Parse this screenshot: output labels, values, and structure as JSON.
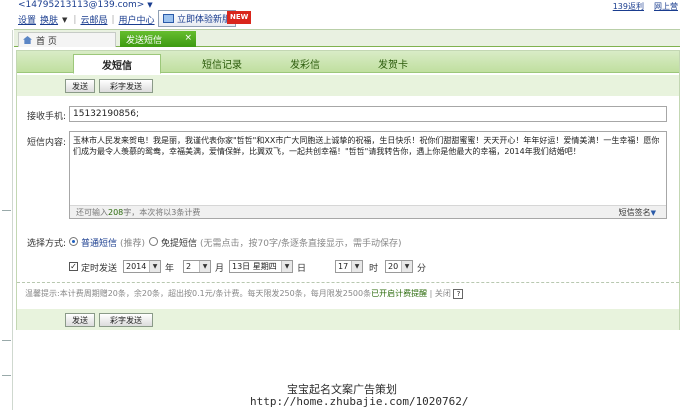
{
  "header": {
    "account": "<14795213113@139.com>",
    "nav": [
      {
        "label": "设置"
      },
      {
        "label": "换肤"
      },
      {
        "label": "云邮局"
      },
      {
        "label": "用户中心"
      }
    ],
    "trial_button": "立即体验新版",
    "new_badge": "NEW",
    "right_links": [
      "139返利",
      "网上营"
    ]
  },
  "tabs": [
    {
      "label": "首 页",
      "active": false
    },
    {
      "label": "发送短信",
      "active": true,
      "close": "×"
    }
  ],
  "subtabs": [
    "发短信",
    "短信记录",
    "发彩信",
    "发贺卡"
  ],
  "toolbar": {
    "send": "发送",
    "colorful": "彩字发送"
  },
  "form": {
    "recipient_label": "接收手机:",
    "recipient_value": "15132190856;",
    "content_label": "短信内容:",
    "content_text": "玉林市人民发来贺电！我是丽，我谨代表你家\"哲哲\"和XX市广大同胞送上诚挚的祝福，生日快乐！祝你们甜甜蜜蜜！天天开心！年年好运！爱情美满！一生幸福！愿你们成为最令人羡慕的鸳鸯，幸福美满，爱情保鲜，比翼双飞，一起共创幸福！\"哲哲\"请我转告你，遇上你是他最大的幸福，2014年我们结婚吧！",
    "remain_prefix": "还可输入",
    "remain_count": "208",
    "remain_suffix": "字，本次将以3条计费",
    "signature": "短信签名",
    "mode_label": "选择方式:",
    "mode_normal": "普通短信",
    "mode_normal_note": "(推荐)",
    "mode_free": "免提短信",
    "mode_free_note": "(无需点击，按70字/条逐条直接显示，需手动保存)",
    "schedule": {
      "label": "定时发送",
      "checked": true,
      "year": "2014",
      "year_unit": "年",
      "month": "2",
      "month_unit": "月",
      "day": "13日 星期四",
      "day_unit": "日",
      "hour": "17",
      "hour_unit": "时",
      "minute": "20",
      "minute_unit": "分"
    }
  },
  "tips": {
    "text": "温馨提示:本计费周期赠20条，余20条，超出按0.1元/条计费。每天限发250条，每月限发2500条",
    "link": "已开启计费提醒",
    "close": "| 关闭",
    "help": "?"
  },
  "watermark": {
    "line1": "宝宝起名文案广告策划",
    "line2": "http://home.zhubajie.com/1020762/"
  },
  "colors": {
    "accent_green": "#4aa81b",
    "link_blue": "#1a3d8f",
    "new_red": "#d9261c"
  }
}
